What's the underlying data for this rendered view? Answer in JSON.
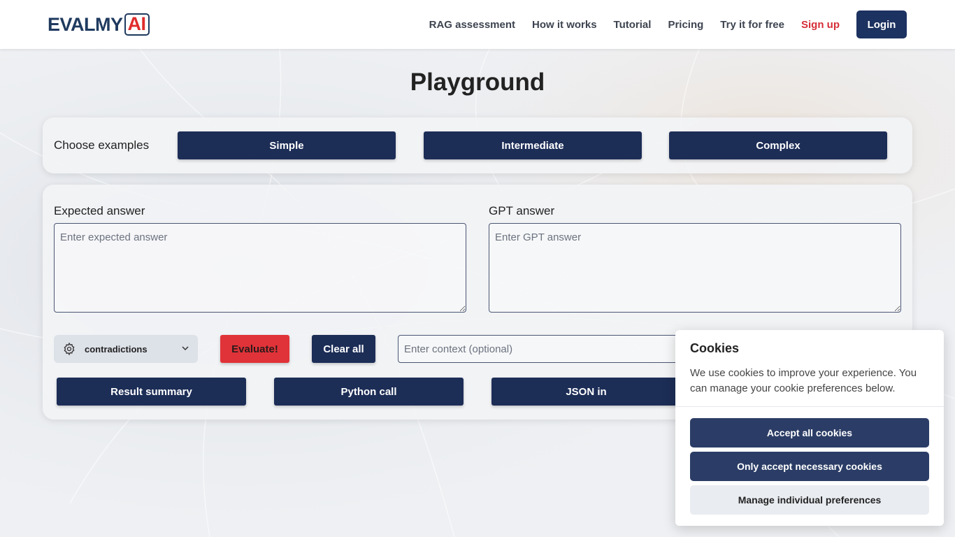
{
  "header": {
    "logo_text": "EVALMY",
    "logo_ai": "AI",
    "nav": [
      {
        "label": "RAG assessment"
      },
      {
        "label": "How it works"
      },
      {
        "label": "Tutorial"
      },
      {
        "label": "Pricing"
      },
      {
        "label": "Try it for free"
      },
      {
        "label": "Sign up"
      }
    ],
    "login_label": "Login"
  },
  "page": {
    "title": "Playground"
  },
  "examples": {
    "label": "Choose examples",
    "buttons": [
      "Simple",
      "Intermediate",
      "Complex"
    ]
  },
  "form": {
    "expected_label": "Expected answer",
    "expected_placeholder": "Enter expected answer",
    "gpt_label": "GPT answer",
    "gpt_placeholder": "Enter GPT answer",
    "metric_value": "contradictions",
    "evaluate_label": "Evaluate!",
    "clear_label": "Clear all",
    "context_placeholder": "Enter context (optional)",
    "tabs": [
      "Result summary",
      "Python call",
      "JSON in"
    ]
  },
  "cookies": {
    "title": "Cookies",
    "text": "We use cookies to improve your experience. You can manage your cookie preferences below.",
    "accept_all": "Accept all cookies",
    "accept_necessary": "Only accept necessary cookies",
    "manage": "Manage individual preferences"
  },
  "colors": {
    "brand_navy": "#1c2d56",
    "accent_red": "#e03339",
    "signup_red": "#d62e38"
  }
}
